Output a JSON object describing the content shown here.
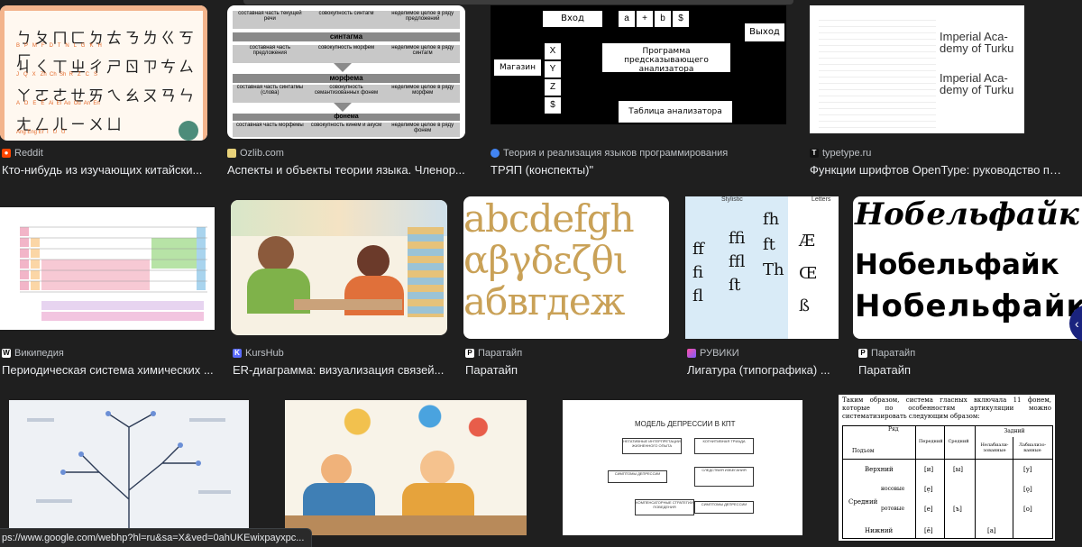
{
  "status_url": "ps://www.google.com/webhp?hl=ru&sa=X&ved=0ahUKEwixpayxpc...",
  "cards": [
    {
      "source": "Reddit",
      "title": "Кто-нибудь из изучающих китайски..."
    },
    {
      "source": "Ozlib.com",
      "title": "Аспекты и объекты теории языка. Членор..."
    },
    {
      "source": "Теория и реализация языков программирования",
      "title": "ТРЯП (конспекты)\""
    },
    {
      "source": "typetype.ru",
      "title": "Функции шрифтов OpenType: руководство по ..."
    },
    {
      "source": "Википедия",
      "title": "Периодическая система химических ..."
    },
    {
      "source": "KursHub",
      "title": "ER-диаграмма: визуализация связей..."
    },
    {
      "source": "Паратайп",
      "title": "Паратайп"
    },
    {
      "source": "РУВИКИ",
      "title": "Лигатура (типографика) ..."
    },
    {
      "source": "Паратайп",
      "title": "Паратайп"
    }
  ],
  "thumbs": {
    "zhuyin": {
      "rows": [
        {
          "glyphs": "ㄅㄆㄇㄈㄉㄊㄋㄌㄍㄎㄏ",
          "latin": "B   P   M   F   D   T   N   L   G   K   H"
        },
        {
          "glyphs": "ㄐㄑㄒㄓㄔㄕㄖㄗㄘㄙ",
          "latin": "J   Q   X   Zh  Ch  Sh  R   Z   C   S"
        },
        {
          "glyphs": "ㄚㄛㄜㄝㄞㄟㄠㄡㄢㄣ",
          "latin": "A   O   E   Ê   Ai  Ei  Ao  Ou  An  En"
        },
        {
          "glyphs": "ㄤㄥㄦㄧㄨㄩ",
          "latin": "Ang Eng Er  I   U   Ü"
        }
      ]
    },
    "ozlib": {
      "top": [
        "составная часть текущей речи",
        "совокупность синтагм",
        "неделимое целое в ряду предложений"
      ],
      "sections": [
        {
          "header": "синтагма",
          "cells": [
            "составная часть предложения",
            "совокупность морфем",
            "неделимое целое в ряду синтагм"
          ]
        },
        {
          "header": "морфема",
          "cells": [
            "составная часть синтагмы (слова)",
            "совокупность семантизованных фонем",
            "неделимое целое в ряду морфем"
          ]
        },
        {
          "header": "фонема",
          "cells": [
            "составная часть морфемы",
            "совокупность кинем и акусм",
            "неделимое целое в ряду фонем"
          ]
        }
      ]
    },
    "tryap": {
      "input_label": "Вход",
      "input_cells": [
        "a",
        "+",
        "b",
        "$"
      ],
      "output_label": "Выход",
      "store_label": "Магазин",
      "stack": [
        "X",
        "Y",
        "Z",
        "$"
      ],
      "program": "Программа предсказывающего анализатора",
      "table": "Таблица анализатора"
    },
    "typetype": {
      "sample_lines": [
        "Imperial Aca-",
        "demy of Turku",
        "Imperial Aca-",
        "demy of Turku"
      ]
    },
    "paratype_latin": {
      "lines": [
        "abcdefgh",
        "αβγδεζθι",
        "абвгдеж"
      ]
    },
    "ligatures": {
      "header_left": "Stylistic",
      "header_right": "Letters",
      "glyphs": [
        "ﬀ",
        "ﬁ",
        "ﬂ",
        "ﬃ",
        "ﬄ",
        "ﬅ",
        "Th",
        "ft",
        "fh",
        "Æ",
        "Œ",
        "ß"
      ]
    },
    "nobel": {
      "lines": [
        "Нобельфайк",
        "Нобельфайк",
        "Нобельфайк"
      ]
    },
    "depression": {
      "title": "МОДЕЛЬ ДЕПРЕССИИ В КПТ",
      "boxes": [
        "НЕГАТИВНЫЕ ИНТЕРПРЕТАЦИИ ЖИЗНЕННОГО ОПЫТА",
        "КОГНИТИВНАЯ ТРИАДА",
        "СИМПТОМЫ ДЕПРЕССИИ",
        "СЛЕДСТВИЯ ИЗБЕГАНИЯ",
        "КОМПЕНСАТОРНЫЕ СТРАТЕГИИ ПОВЕДЕНИЯ",
        "СИМПТОМЫ ДЕПРЕССИИ"
      ]
    },
    "vowels": {
      "text": "Таким образом, система гласных включала 11 фонем, которые по особенностям артикуляции можно систематизировать следующим образом:",
      "row_header": "Ряд",
      "col_header": "Подъем",
      "cols": [
        "Передний",
        "Средний",
        "Нелабиали-зованные",
        "Лабиализо-ванные"
      ],
      "group": "Задний",
      "rows": [
        {
          "label": "Верхний",
          "cells": [
            "[и]",
            "[ы]",
            "",
            "[у]"
          ]
        },
        {
          "label": "Средний",
          "sub": "носовые",
          "cells": [
            "[ẹ]",
            "",
            "",
            "[ǫ]"
          ]
        },
        {
          "label": "",
          "sub": "ротовые",
          "cells": [
            "[е]",
            "[ъ]",
            "",
            "[о]"
          ]
        },
        {
          "label": "Нижний",
          "cells": [
            "[ě]",
            "",
            "[а]",
            ""
          ]
        }
      ]
    }
  }
}
